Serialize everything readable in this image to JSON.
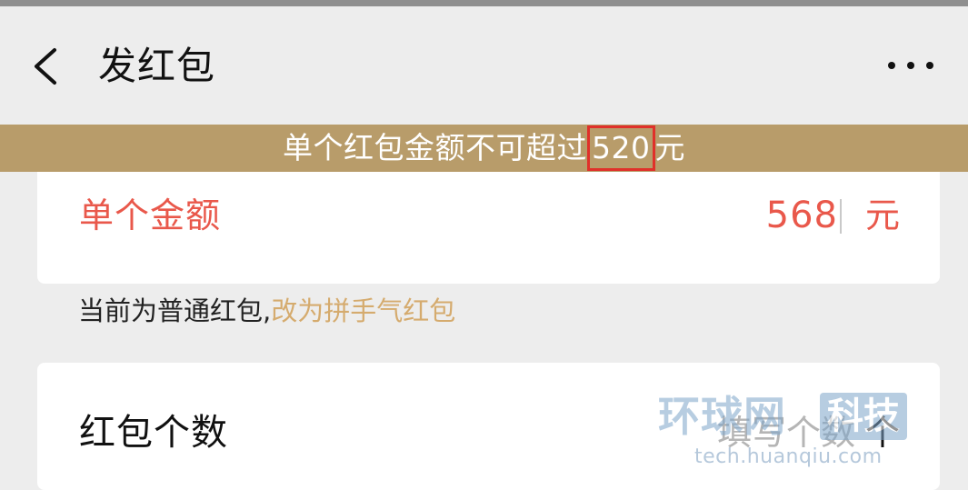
{
  "nav": {
    "back_icon": "chevron-left-icon",
    "title": "发红包",
    "more_icon": "more-horizontal-icon"
  },
  "warning": {
    "prefix": "单个红包金额不可超过",
    "limit": "520",
    "suffix": "元"
  },
  "amount_card": {
    "label": "单个金额",
    "value": "568",
    "unit": "元"
  },
  "hint": {
    "text": "当前为普通红包,",
    "link": "改为拼手气红包"
  },
  "count_card": {
    "label": "红包个数",
    "placeholder": "填写个数",
    "unit": "个"
  },
  "watermark": {
    "left": "环球网",
    "right": "科技",
    "url": "tech.huanqiu.com"
  },
  "colors": {
    "warning_bg": "#b89c6a",
    "error_red": "#e9584b",
    "link_gold": "#d5ab6e",
    "highlight_box": "#e0302a"
  }
}
